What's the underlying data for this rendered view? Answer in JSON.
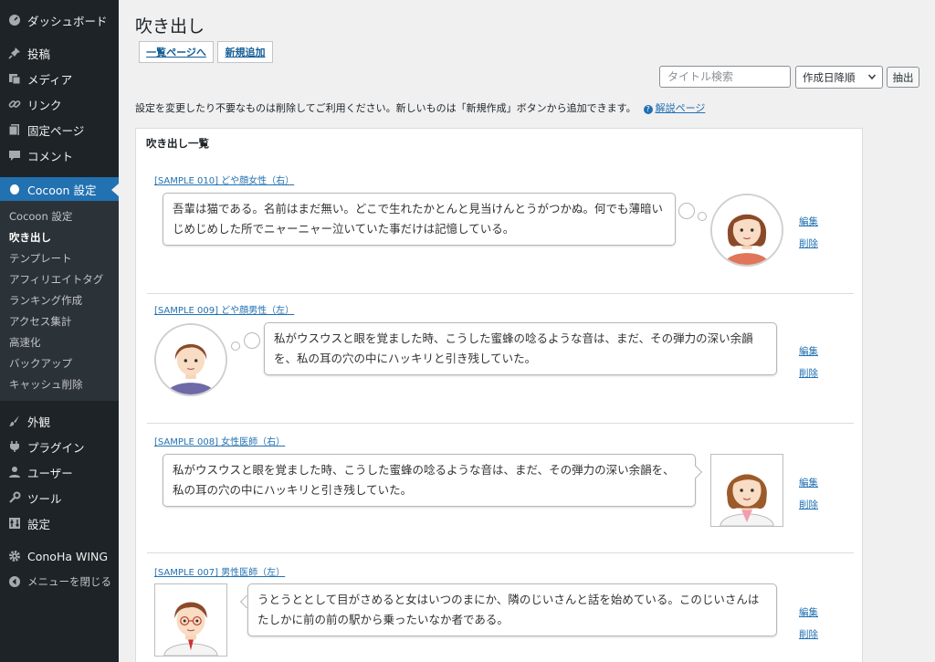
{
  "sidebar": {
    "top_items": [
      {
        "label": "ダッシュボード",
        "icon": "dashboard-icon"
      },
      {
        "label": "投稿",
        "icon": "pin-icon"
      },
      {
        "label": "メディア",
        "icon": "media-icon"
      },
      {
        "label": "リンク",
        "icon": "link-icon"
      },
      {
        "label": "固定ページ",
        "icon": "page-icon"
      },
      {
        "label": "コメント",
        "icon": "comment-icon"
      }
    ],
    "active_item": {
      "label": "Cocoon 設定",
      "icon": "cocoon-icon"
    },
    "submenu": [
      {
        "label": "Cocoon 設定"
      },
      {
        "label": "吹き出し"
      },
      {
        "label": "テンプレート"
      },
      {
        "label": "アフィリエイトタグ"
      },
      {
        "label": "ランキング作成"
      },
      {
        "label": "アクセス集計"
      },
      {
        "label": "高速化"
      },
      {
        "label": "バックアップ"
      },
      {
        "label": "キャッシュ削除"
      }
    ],
    "bottom_items": [
      {
        "label": "外観",
        "icon": "brush-icon"
      },
      {
        "label": "プラグイン",
        "icon": "plugin-icon"
      },
      {
        "label": "ユーザー",
        "icon": "user-icon"
      },
      {
        "label": "ツール",
        "icon": "wrench-icon"
      },
      {
        "label": "設定",
        "icon": "settings-icon"
      }
    ],
    "extra_items": [
      {
        "label": "ConoHa WING",
        "icon": "gear-icon"
      },
      {
        "label": "メニューを閉じる",
        "icon": "collapse-icon"
      }
    ]
  },
  "main": {
    "title": "吹き出し",
    "list_button": "一覧ページへ",
    "new_button": "新規追加",
    "search_placeholder": "タイトル検索",
    "sort_value": "作成日降順",
    "extract_button": "抽出",
    "info_text": "設定を変更したり不要なものは削除してご利用ください。新しいものは「新規作成」ボタンから追加できます。",
    "help_link": "解説ページ"
  },
  "panel": {
    "title": "吹き出し一覧",
    "edit_label": "編集",
    "delete_label": "削除",
    "entries": [
      {
        "title": "[SAMPLE 010] どや顔女性（右）",
        "text": "吾輩は猫である。名前はまだ無い。どこで生れたかとんと見当けんとうがつかぬ。何でも薄暗いじめじめした所でニャーニャー泣いていた事だけは記憶している。"
      },
      {
        "title": "[SAMPLE 009] どや顔男性（左）",
        "text": "私がウスウスと眼を覚ました時、こうした蜜蜂の唸るような音は、まだ、その弾力の深い余韻を、私の耳の穴の中にハッキリと引き残していた。"
      },
      {
        "title": "[SAMPLE 008] 女性医師（右）",
        "text": "私がウスウスと眼を覚ました時、こうした蜜蜂の唸るような音は、まだ、その弾力の深い余韻を、私の耳の穴の中にハッキリと引き残していた。"
      },
      {
        "title": "[SAMPLE 007] 男性医師（左）",
        "text": "うとうととして目がさめると女はいつのまにか、隣のじいさんと話を始めている。このじいさんはたしかに前の前の駅から乗ったいなか者である。"
      }
    ]
  },
  "colors": {
    "sidebar_bg": "#1d2327",
    "active_blue": "#2271b1",
    "link_blue": "#2271b1"
  }
}
